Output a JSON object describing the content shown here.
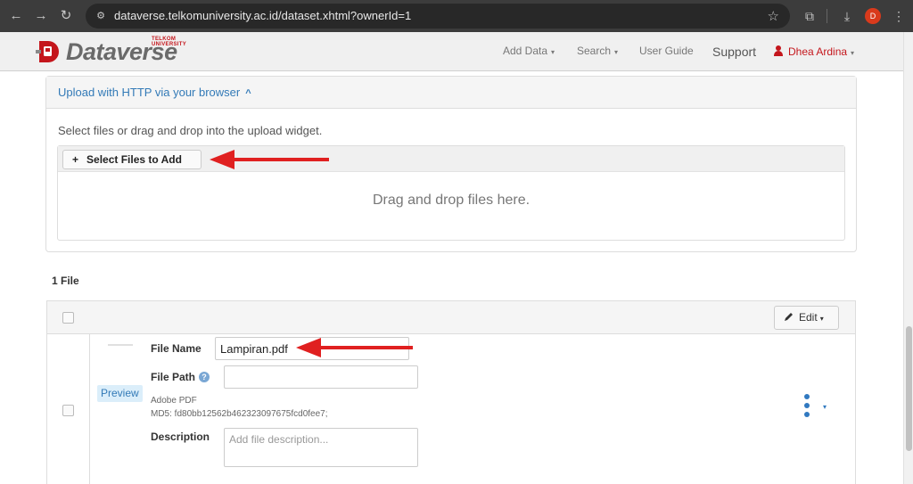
{
  "browser": {
    "url": "dataverse.telkomuniversity.ac.id/dataset.xhtml?ownerId=1",
    "profile_initial": "D"
  },
  "navbar": {
    "logo_text": "Dataverse",
    "logo_sub": "TELKOM UNIVERSITY",
    "items": [
      {
        "label": "Add Data",
        "caret": "▾"
      },
      {
        "label": "Search",
        "caret": "▾"
      },
      {
        "label": "User Guide"
      },
      {
        "label": "Support"
      }
    ],
    "user": {
      "label": "Dhea Ardina",
      "caret": "▾"
    }
  },
  "upload": {
    "header": "Upload with HTTP via your browser",
    "hint": "Select files or drag and drop into the upload widget.",
    "select_button": "Select Files to Add",
    "drop_text": "Drag and drop files here."
  },
  "files": {
    "count_label": "1 File",
    "edit_label": "Edit",
    "rows": [
      {
        "preview_label": "Preview",
        "file_name_label": "File Name",
        "file_name": "Lampiran.pdf",
        "file_path_label": "File Path",
        "file_path": "",
        "type": "Adobe PDF",
        "md5": "MD5: fd80bb12562b462323097675fcd0fee7;",
        "description_label": "Description",
        "description_placeholder": "Add file description..."
      }
    ]
  },
  "colors": {
    "link": "#337ab7",
    "brand_red": "#c4161c",
    "arrow_red": "#e02020"
  }
}
